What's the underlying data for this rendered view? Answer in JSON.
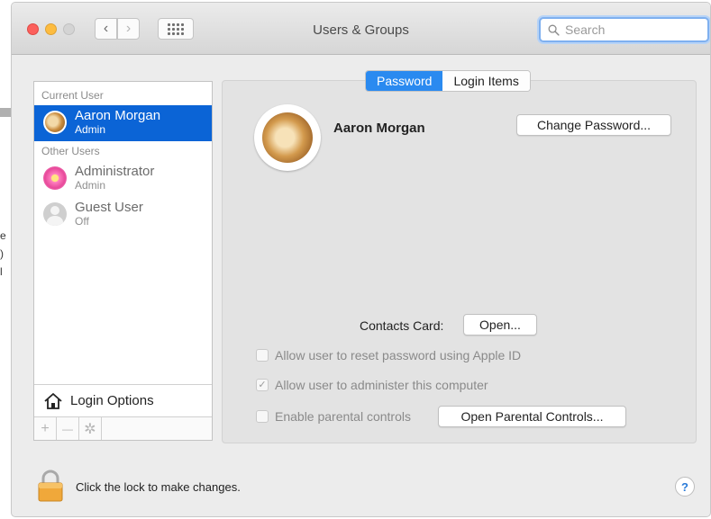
{
  "window": {
    "title": "Users & Groups"
  },
  "toolbar": {
    "back_icon": "‹",
    "forward_icon": "›",
    "search_placeholder": "Search"
  },
  "sidebar": {
    "current_user_header": "Current User",
    "other_users_header": "Other Users",
    "current_user": {
      "name": "Aaron Morgan",
      "role": "Admin"
    },
    "other_users": [
      {
        "name": "Administrator",
        "role": "Admin"
      },
      {
        "name": "Guest User",
        "role": "Off"
      }
    ],
    "login_options_label": "Login Options",
    "add_icon": "+",
    "remove_icon": "—",
    "gear_icon": "✲"
  },
  "tabs": {
    "password": "Password",
    "login_items": "Login Items"
  },
  "main": {
    "user_name": "Aaron Morgan",
    "change_password_label": "Change Password...",
    "contacts_card_label": "Contacts Card:",
    "open_label": "Open...",
    "check_reset_label": "Allow user to reset password using Apple ID",
    "check_admin_label": "Allow user to administer this computer",
    "check_admin_mark": "✓",
    "check_parental_label": "Enable parental controls",
    "open_parental_label": "Open Parental Controls..."
  },
  "footer": {
    "lock_text": "Click the lock to make changes.",
    "help_label": "?"
  },
  "colors": {
    "selection": "#0b64d6",
    "active_tab": "#2a8af0",
    "search_focus": "#7fb0ef"
  }
}
